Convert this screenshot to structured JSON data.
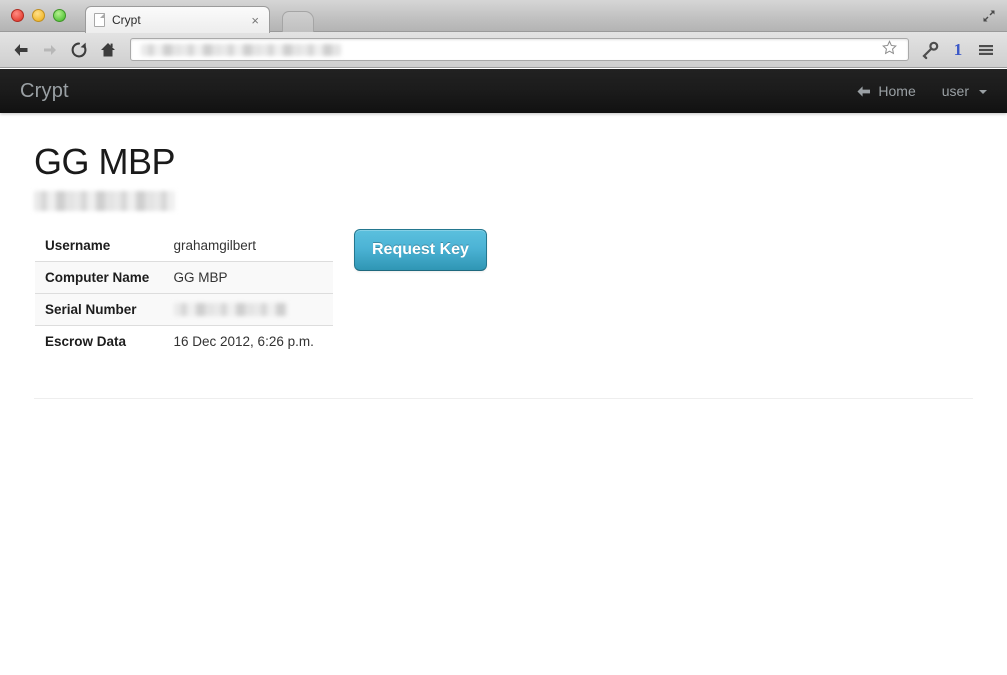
{
  "browser": {
    "tab": {
      "title": "Crypt",
      "favicon_icon": "page-icon",
      "close_icon": "close-icon"
    },
    "window_controls": {
      "close": "close-window",
      "minimize": "minimize-window",
      "zoom": "zoom-window"
    },
    "fullscreen_icon": "fullscreen-expand-icon",
    "new_tab_icon": "new-tab-icon",
    "toolbar": {
      "back_icon": "back-arrow-icon",
      "forward_icon": "forward-arrow-icon",
      "reload_icon": "reload-icon",
      "home_icon": "home-icon",
      "bookmark_icon": "star-icon",
      "extension_icon": "key-icon",
      "extension_badge": "1",
      "menu_icon": "hamburger-menu-icon",
      "address_value": "",
      "address_placeholder": "",
      "address_redacted": true
    }
  },
  "page": {
    "navbar": {
      "brand": "Crypt",
      "links": [
        {
          "label": "Home",
          "icon": "arrow-left-icon",
          "name": "nav-home"
        },
        {
          "label": "user",
          "icon": "caret-down-icon",
          "name": "nav-user-dropdown"
        }
      ]
    },
    "title": "GG MBP",
    "subtitle_redacted": true,
    "table": {
      "rows": [
        {
          "key": "Username",
          "value": "grahamgilbert",
          "redacted": false
        },
        {
          "key": "Computer Name",
          "value": "GG MBP",
          "redacted": false
        },
        {
          "key": "Serial Number",
          "value": "",
          "redacted": true
        },
        {
          "key": "Escrow Data",
          "value": "16 Dec 2012, 6:26 p.m.",
          "redacted": false
        }
      ]
    },
    "actions": {
      "request_key": "Request Key"
    },
    "colors": {
      "navbar_bg": "#1b1b1b",
      "navbar_text": "#9aa0a4",
      "button_top": "#5bc0de",
      "button_bottom": "#2f96b4",
      "table_border": "#dddddd",
      "stripe_bg": "#f9f9f9"
    }
  }
}
